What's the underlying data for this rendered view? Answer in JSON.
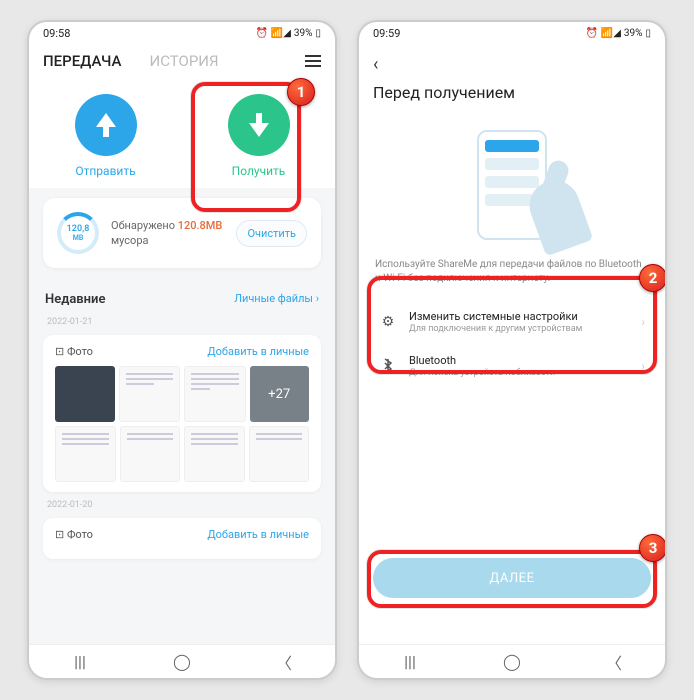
{
  "phone1": {
    "status": {
      "time": "09:58",
      "battery": "39%",
      "icons": "⏰ 📶◢"
    },
    "tabs": {
      "transfer": "ПЕРЕДАЧА",
      "history": "ИСТОРИЯ"
    },
    "actions": {
      "send": "Отправить",
      "receive": "Получить"
    },
    "storage": {
      "value": "120,8",
      "unit": "MB",
      "text1": "Обнаружено",
      "text2": "120.8MB",
      "text3": "мусора",
      "clean": "Очистить"
    },
    "recent": {
      "title": "Недавние",
      "link": "Личные файлы ›"
    },
    "group1": {
      "date": "2022-01-21",
      "type": "⊡ Фото",
      "action": "Добавить в личные",
      "more": "+27"
    },
    "group2": {
      "date": "2022-01-20",
      "type": "⊡ Фото",
      "action": "Добавить в личные"
    }
  },
  "phone2": {
    "status": {
      "time": "09:59",
      "battery": "39%",
      "icons": "⏰ 📶◢"
    },
    "title": "Перед получением",
    "desc": "Используйте ShareMe для передачи файлов по Bluetooth и Wi-Fi без подключения к интернету.",
    "perm1": {
      "title": "Изменить системные настройки",
      "sub": "Для подключения к другим устройствам"
    },
    "perm2": {
      "title": "Bluetooth",
      "sub": "Для поиска устройств поблизости"
    },
    "next": "ДАЛЕЕ"
  },
  "badges": {
    "b1": "1",
    "b2": "2",
    "b3": "3"
  }
}
